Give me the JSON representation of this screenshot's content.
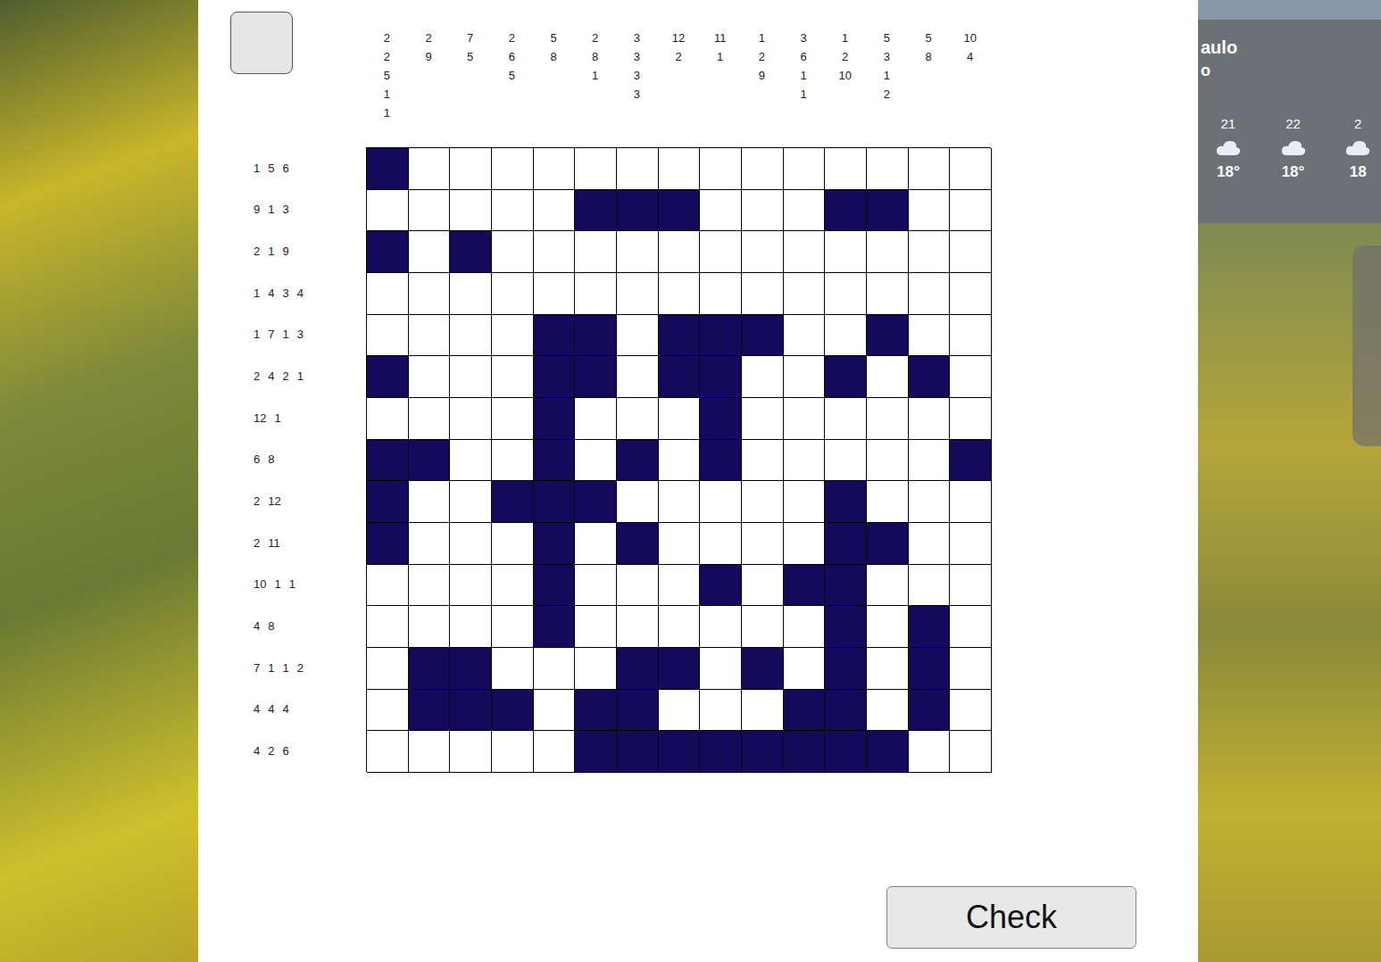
{
  "puzzle": {
    "column_clues": [
      [
        "2",
        "2",
        "5",
        "1",
        "1"
      ],
      [
        "2",
        "9"
      ],
      [
        "7",
        "5"
      ],
      [
        "2",
        "6",
        "5"
      ],
      [
        "5",
        "8"
      ],
      [
        "2",
        "8",
        "1"
      ],
      [
        "3",
        "3",
        "3",
        "3"
      ],
      [
        "12",
        "2"
      ],
      [
        "11",
        "1"
      ],
      [
        "1",
        "2",
        "9"
      ],
      [
        "3",
        "6",
        "1",
        "1"
      ],
      [
        "1",
        "2",
        "10"
      ],
      [
        "5",
        "3",
        "1",
        "2"
      ],
      [
        "5",
        "8"
      ],
      [
        "10",
        "4"
      ]
    ],
    "row_clues": [
      [
        "1",
        "5",
        "6"
      ],
      [
        "9",
        "1",
        "3"
      ],
      [
        "2",
        "1",
        "9"
      ],
      [
        "1",
        "4",
        "3",
        "4"
      ],
      [
        "1",
        "7",
        "1",
        "3"
      ],
      [
        "2",
        "4",
        "2",
        "1"
      ],
      [
        "12",
        "1"
      ],
      [
        "6",
        "8"
      ],
      [
        "2",
        "12"
      ],
      [
        "2",
        "11"
      ],
      [
        "10",
        "1",
        "1"
      ],
      [
        "4",
        "8"
      ],
      [
        "7",
        "1",
        "1",
        "2"
      ],
      [
        "4",
        "4",
        "4"
      ],
      [
        "4",
        "2",
        "6"
      ]
    ],
    "cells": [
      [
        true,
        false,
        false,
        false,
        false,
        false,
        false,
        false,
        false,
        false,
        false,
        false,
        false,
        false,
        false
      ],
      [
        false,
        false,
        false,
        false,
        false,
        true,
        true,
        true,
        false,
        false,
        false,
        true,
        true,
        false,
        false
      ],
      [
        true,
        false,
        true,
        false,
        false,
        false,
        false,
        false,
        false,
        false,
        false,
        false,
        false,
        false,
        false
      ],
      [
        false,
        false,
        false,
        false,
        false,
        false,
        false,
        false,
        false,
        false,
        false,
        false,
        false,
        false,
        false
      ],
      [
        false,
        false,
        false,
        false,
        true,
        true,
        false,
        true,
        true,
        true,
        false,
        false,
        true,
        false,
        false
      ],
      [
        true,
        false,
        false,
        false,
        true,
        true,
        false,
        true,
        true,
        false,
        false,
        true,
        false,
        true,
        false
      ],
      [
        false,
        false,
        false,
        false,
        true,
        false,
        false,
        false,
        true,
        false,
        false,
        false,
        false,
        false,
        false
      ],
      [
        true,
        true,
        false,
        false,
        true,
        false,
        true,
        false,
        true,
        false,
        false,
        false,
        false,
        false,
        true
      ],
      [
        true,
        false,
        false,
        true,
        true,
        true,
        false,
        false,
        false,
        false,
        false,
        true,
        false,
        false,
        false
      ],
      [
        true,
        false,
        false,
        false,
        true,
        false,
        true,
        false,
        false,
        false,
        false,
        true,
        true,
        false,
        false
      ],
      [
        false,
        false,
        false,
        false,
        true,
        false,
        false,
        false,
        true,
        false,
        true,
        true,
        false,
        false,
        false
      ],
      [
        false,
        false,
        false,
        false,
        true,
        false,
        false,
        false,
        false,
        false,
        false,
        true,
        false,
        true,
        false
      ],
      [
        false,
        true,
        true,
        false,
        false,
        false,
        true,
        true,
        false,
        true,
        false,
        true,
        false,
        true,
        false
      ],
      [
        false,
        true,
        true,
        true,
        false,
        true,
        true,
        false,
        false,
        false,
        true,
        true,
        false,
        true,
        false
      ],
      [
        false,
        false,
        false,
        false,
        false,
        true,
        true,
        true,
        true,
        true,
        true,
        true,
        true,
        false,
        false
      ]
    ]
  },
  "check_button": "Check",
  "weather": {
    "city": "aulo",
    "subtitle": "o",
    "hours": [
      {
        "time": "21",
        "temp": "18°"
      },
      {
        "time": "22",
        "temp": "18°"
      },
      {
        "time": "2",
        "temp": "18"
      }
    ]
  }
}
